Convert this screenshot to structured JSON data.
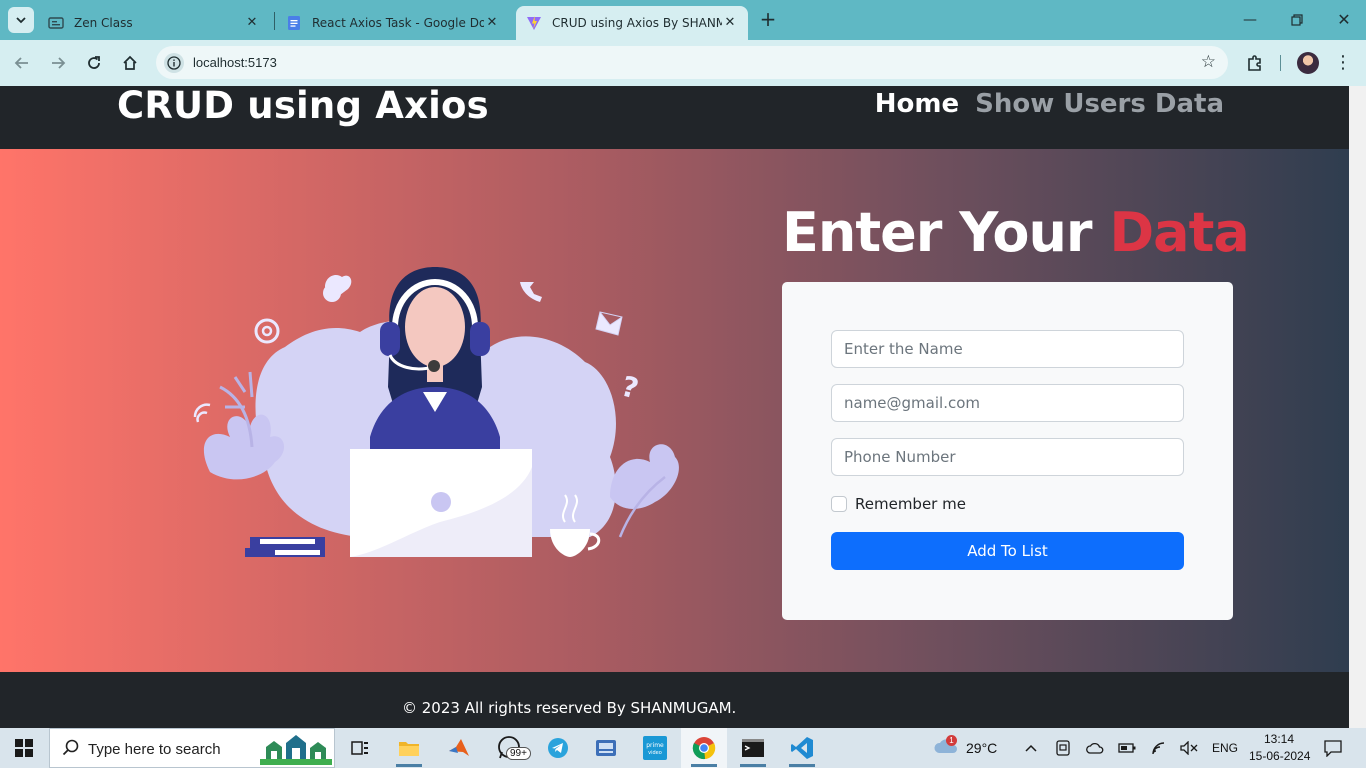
{
  "browser": {
    "tabs": [
      {
        "title": "Zen Class"
      },
      {
        "title": "React Axios Task - Google Docs"
      },
      {
        "title": "CRUD using Axios By SHANMU"
      }
    ],
    "url": "localhost:5173"
  },
  "navbar": {
    "brand": "CRUD using Axios",
    "links": [
      "Home",
      "Show Users Data"
    ]
  },
  "hero": {
    "heading_main": "Enter Your",
    "heading_accent": "Data",
    "form": {
      "name_placeholder": "Enter the Name",
      "email_placeholder": "name@gmail.com",
      "phone_placeholder": "Phone Number",
      "remember_label": "Remember me",
      "submit_label": "Add To List"
    }
  },
  "footer": {
    "text": "© 2023 All rights reserved By SHANMUGAM."
  },
  "taskbar": {
    "search_placeholder": "Type here to search",
    "whatsapp_badge": "99+",
    "weather_badge": "1",
    "temperature": "29°C",
    "language": "ENG",
    "time": "13:14",
    "date": "15-06-2024"
  },
  "colors": {
    "accent_red": "#dc3545",
    "primary_blue": "#0d6efd",
    "navbar_dark": "#212529",
    "browser_teal": "#5fb8c4"
  }
}
